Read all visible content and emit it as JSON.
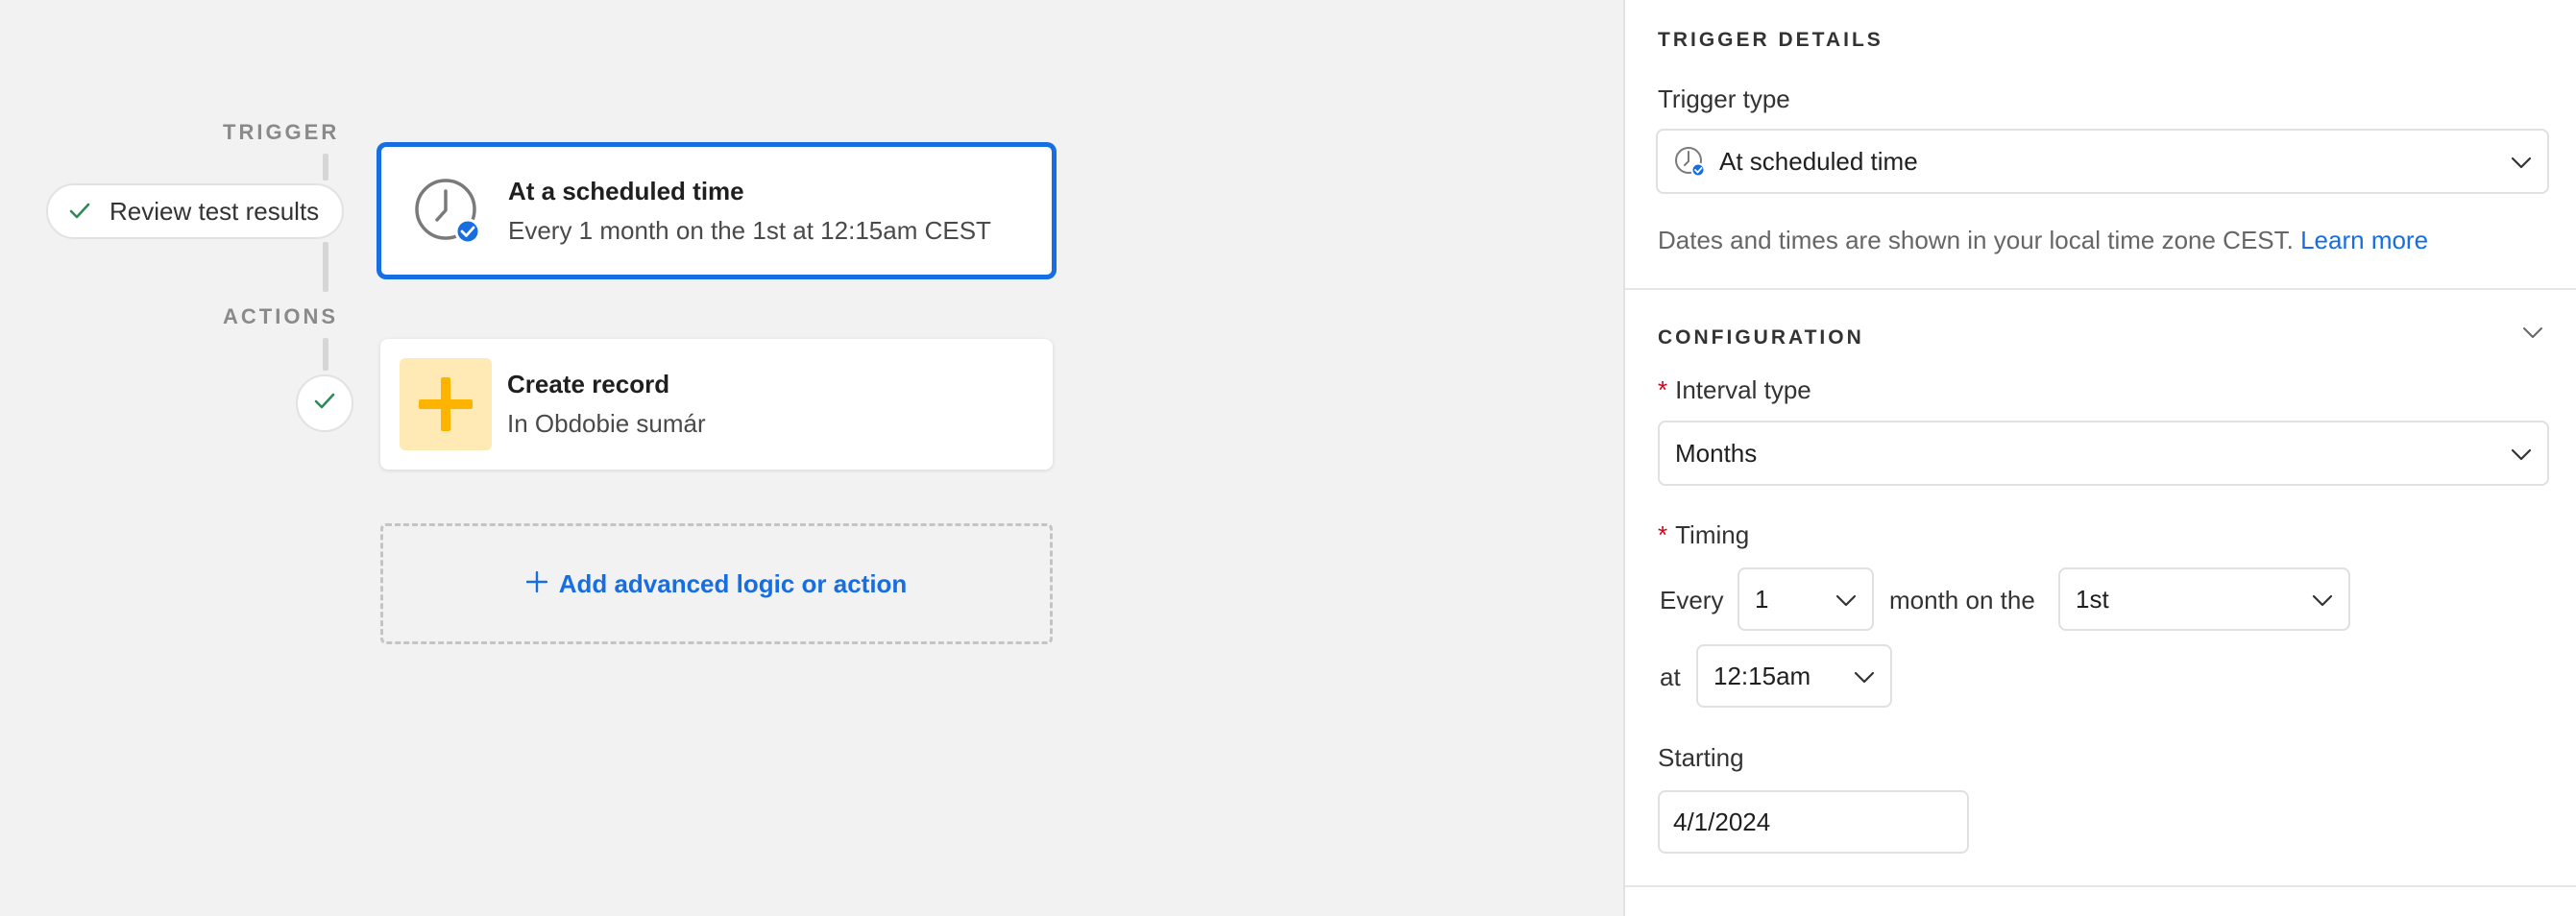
{
  "canvas": {
    "trigger_label": "TRIGGER",
    "actions_label": "ACTIONS",
    "review_pill": "Review test results",
    "trigger_card": {
      "title": "At a scheduled time",
      "subtitle": "Every 1 month on the 1st at 12:15am CEST"
    },
    "action_card": {
      "title": "Create record",
      "subtitle": "In Obdobie sumár"
    },
    "add_logic": "Add advanced logic or action"
  },
  "panel": {
    "trigger_details_heading": "TRIGGER DETAILS",
    "trigger_type_label": "Trigger type",
    "trigger_type_value": "At scheduled time",
    "timezone_help": "Dates and times are shown in your local time zone CEST.",
    "learn_more": "Learn more",
    "configuration_heading": "CONFIGURATION",
    "interval_type_label": "Interval type",
    "interval_type_value": "Months",
    "timing_label": "Timing",
    "every_text": "Every",
    "every_value": "1",
    "month_on_the_text": "month on the",
    "day_value": "1st",
    "at_text": "at",
    "time_value": "12:15am",
    "starting_label": "Starting",
    "starting_value": "4/1/2024"
  },
  "colors": {
    "accent": "#166ee1",
    "check": "#2e8b57",
    "required": "#d0021b",
    "plus_icon": "#fcb400",
    "plus_bg": "#ffeab6"
  }
}
